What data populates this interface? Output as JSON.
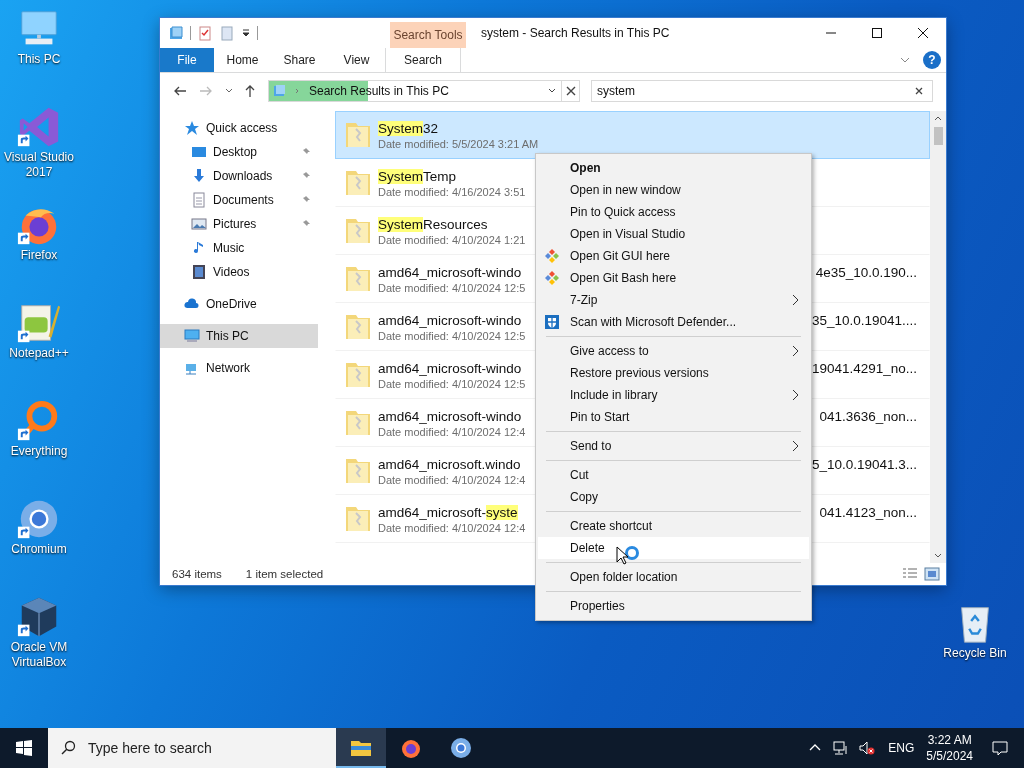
{
  "desktop_icons": [
    {
      "label": "This PC",
      "kind": "pc",
      "shortcut": false
    },
    {
      "label": "Visual Studio 2017",
      "kind": "vs",
      "shortcut": true
    },
    {
      "label": "Firefox",
      "kind": "firefox",
      "shortcut": true
    },
    {
      "label": "Notepad++",
      "kind": "notepad",
      "shortcut": true
    },
    {
      "label": "Everything",
      "kind": "everything",
      "shortcut": true
    },
    {
      "label": "Chromium",
      "kind": "chromium",
      "shortcut": true
    },
    {
      "label": "Oracle VM VirtualBox",
      "kind": "virtualbox",
      "shortcut": true
    }
  ],
  "recycle_bin": {
    "label": "Recycle Bin"
  },
  "window": {
    "title": "system - Search Results in This PC",
    "context_tab": "Search Tools",
    "tabs": [
      {
        "label": "File",
        "kind": "file",
        "selected": false
      },
      {
        "label": "Home",
        "kind": "tab",
        "selected": false
      },
      {
        "label": "Share",
        "kind": "tab",
        "selected": false
      },
      {
        "label": "View",
        "kind": "tab",
        "selected": false
      },
      {
        "label": "Search",
        "kind": "context",
        "selected": false
      }
    ],
    "help": "?",
    "address": {
      "value": "Search Results in This PC",
      "level": 0.34
    },
    "search": {
      "value": "system"
    },
    "nav": [
      {
        "label": "Quick access",
        "kind": "star",
        "selected": false,
        "children": [
          {
            "label": "Desktop",
            "kind": "desktop",
            "pinned": true,
            "selected": false
          },
          {
            "label": "Downloads",
            "kind": "download",
            "pinned": true,
            "selected": false
          },
          {
            "label": "Documents",
            "kind": "document",
            "pinned": true,
            "selected": false
          },
          {
            "label": "Pictures",
            "kind": "picture",
            "pinned": true,
            "selected": false
          },
          {
            "label": "Music",
            "kind": "music",
            "pinned": false,
            "selected": false
          },
          {
            "label": "Videos",
            "kind": "video",
            "pinned": false,
            "selected": false
          }
        ]
      },
      {
        "label": "OneDrive",
        "kind": "cloud",
        "selected": false
      },
      {
        "label": "This PC",
        "kind": "pc",
        "selected": true
      },
      {
        "label": "Network",
        "kind": "network",
        "selected": false
      }
    ],
    "files": [
      {
        "name": [
          {
            "text": "System",
            "highlight": true
          },
          {
            "text": "32",
            "highlight": false
          }
        ],
        "date": "Date modified: 5/5/2024 3:21 AM",
        "selected": true
      },
      {
        "name": [
          {
            "text": "System",
            "highlight": true
          },
          {
            "text": "Temp",
            "highlight": false
          }
        ],
        "date": "Date modified: 4/16/2024 3:51",
        "selected": false
      },
      {
        "name": [
          {
            "text": "System",
            "highlight": true
          },
          {
            "text": "Resources",
            "highlight": false
          }
        ],
        "date": "Date modified: 4/10/2024 1:21",
        "selected": false
      },
      {
        "name": [
          {
            "text": "amd64_microsoft-windo",
            "highlight": false
          }
        ],
        "tail": "4e35_10.0.190...",
        "date": "Date modified: 4/10/2024 12:5",
        "selected": false
      },
      {
        "name": [
          {
            "text": "amd64_microsoft-windo",
            "highlight": false
          }
        ],
        "tail": "35_10.0.19041....",
        "date": "Date modified: 4/10/2024 12:5",
        "selected": false
      },
      {
        "name": [
          {
            "text": "amd64_microsoft-windo",
            "highlight": false
          }
        ],
        "tail": "19041.4291_no...",
        "date": "Date modified: 4/10/2024 12:5",
        "selected": false
      },
      {
        "name": [
          {
            "text": "amd64_microsoft-windo",
            "highlight": false
          }
        ],
        "tail": "041.3636_non...",
        "date": "Date modified: 4/10/2024 12:4",
        "selected": false
      },
      {
        "name": [
          {
            "text": "amd64_microsoft.windo",
            "highlight": false
          }
        ],
        "tail": "5_10.0.19041.3...",
        "date": "Date modified: 4/10/2024 12:4",
        "selected": false
      },
      {
        "name": [
          {
            "text": "amd64_microsoft-",
            "highlight": false
          },
          {
            "text": "syste",
            "highlight": true
          }
        ],
        "tail": "041.4123_non...",
        "date": "Date modified: 4/10/2024 12:4",
        "selected": false
      }
    ],
    "status": {
      "count": "634 items",
      "selection": "1 item selected"
    }
  },
  "context_menu": {
    "groups": [
      [
        {
          "label": "Open",
          "kind": "plain",
          "default": true,
          "submenu": false,
          "selected": false
        },
        {
          "label": "Open in new window",
          "kind": "plain",
          "default": false,
          "submenu": false,
          "selected": false
        },
        {
          "label": "Pin to Quick access",
          "kind": "plain",
          "default": false,
          "submenu": false,
          "selected": false
        },
        {
          "label": "Open in Visual Studio",
          "kind": "plain",
          "default": false,
          "submenu": false,
          "selected": false
        },
        {
          "label": "Open Git GUI here",
          "kind": "git",
          "default": false,
          "submenu": false,
          "selected": false
        },
        {
          "label": "Open Git Bash here",
          "kind": "git",
          "default": false,
          "submenu": false,
          "selected": false
        },
        {
          "label": "7-Zip",
          "kind": "plain",
          "default": false,
          "submenu": true,
          "selected": false
        },
        {
          "label": "Scan with Microsoft Defender...",
          "kind": "shield",
          "default": false,
          "submenu": false,
          "selected": false
        }
      ],
      [
        {
          "label": "Give access to",
          "kind": "plain",
          "default": false,
          "submenu": true,
          "selected": false
        },
        {
          "label": "Restore previous versions",
          "kind": "plain",
          "default": false,
          "submenu": false,
          "selected": false
        },
        {
          "label": "Include in library",
          "kind": "plain",
          "default": false,
          "submenu": true,
          "selected": false
        },
        {
          "label": "Pin to Start",
          "kind": "plain",
          "default": false,
          "submenu": false,
          "selected": false
        }
      ],
      [
        {
          "label": "Send to",
          "kind": "plain",
          "default": false,
          "submenu": true,
          "selected": false
        }
      ],
      [
        {
          "label": "Cut",
          "kind": "plain",
          "default": false,
          "submenu": false,
          "selected": false
        },
        {
          "label": "Copy",
          "kind": "plain",
          "default": false,
          "submenu": false,
          "selected": false
        }
      ],
      [
        {
          "label": "Create shortcut",
          "kind": "plain",
          "default": false,
          "submenu": false,
          "selected": false
        },
        {
          "label": "Delete",
          "kind": "plain",
          "default": false,
          "submenu": false,
          "selected": true
        }
      ],
      [
        {
          "label": "Open folder location",
          "kind": "plain",
          "default": false,
          "submenu": false,
          "selected": false
        }
      ],
      [
        {
          "label": "Properties",
          "kind": "plain",
          "default": false,
          "submenu": false,
          "selected": false
        }
      ]
    ]
  },
  "taskbar": {
    "search_placeholder": "Type here to search",
    "apps": [
      {
        "kind": "explorer",
        "active": true
      },
      {
        "kind": "firefox",
        "active": false
      },
      {
        "kind": "chromium",
        "active": false
      }
    ],
    "language": "ENG",
    "time": "3:22 AM",
    "date": "5/5/2024"
  }
}
